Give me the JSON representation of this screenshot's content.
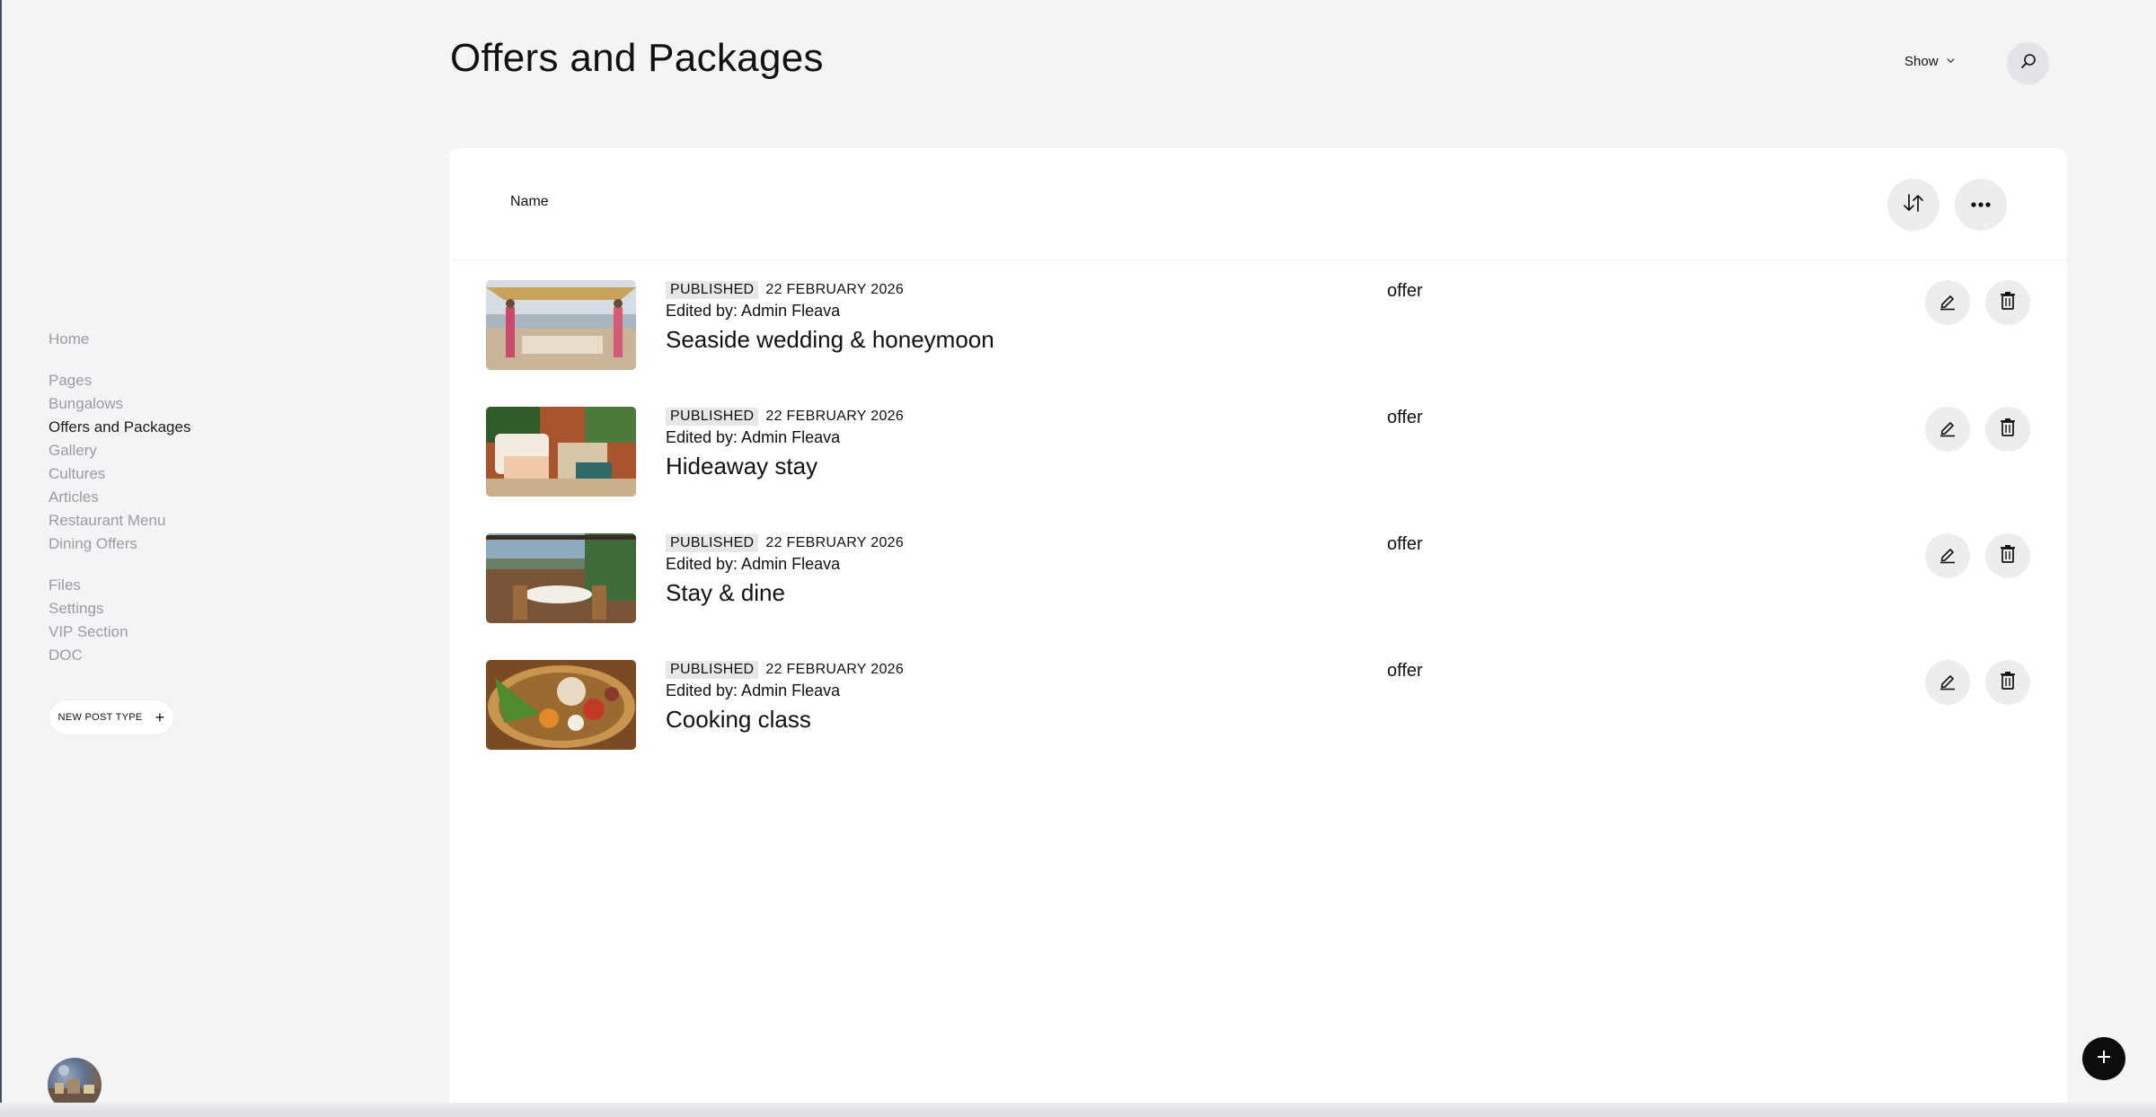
{
  "header": {
    "title": "Offers and Packages",
    "show_label": "Show"
  },
  "sidebar": {
    "groups": [
      [
        {
          "label": "Home",
          "active": false
        }
      ],
      [
        {
          "label": "Pages",
          "active": false
        },
        {
          "label": "Bungalows",
          "active": false
        },
        {
          "label": "Offers and Packages",
          "active": true
        },
        {
          "label": "Gallery",
          "active": false
        },
        {
          "label": "Cultures",
          "active": false
        },
        {
          "label": "Articles",
          "active": false
        },
        {
          "label": "Restaurant Menu",
          "active": false
        },
        {
          "label": "Dining Offers",
          "active": false
        }
      ],
      [
        {
          "label": "Files",
          "active": false
        },
        {
          "label": "Settings",
          "active": false
        },
        {
          "label": "VIP Section",
          "active": false
        },
        {
          "label": "DOC",
          "active": false
        }
      ]
    ],
    "new_post_type_label": "NEW POST TYPE"
  },
  "table": {
    "column_name": "Name",
    "rows": [
      {
        "status": "PUBLISHED",
        "date": "22 FEBRUARY 2026",
        "edited_by": "Edited by: Admin Fleava",
        "title": "Seaside wedding & honeymoon",
        "type": "offer",
        "thumbnail": "beach-wedding-image"
      },
      {
        "status": "PUBLISHED",
        "date": "22 FEBRUARY 2026",
        "edited_by": "Edited by: Admin Fleava",
        "title": "Hideaway stay",
        "type": "offer",
        "thumbnail": "bedroom-image"
      },
      {
        "status": "PUBLISHED",
        "date": "22 FEBRUARY 2026",
        "edited_by": "Edited by: Admin Fleava",
        "title": "Stay & dine",
        "type": "offer",
        "thumbnail": "restaurant-terrace-image"
      },
      {
        "status": "PUBLISHED",
        "date": "22 FEBRUARY 2026",
        "edited_by": "Edited by: Admin Fleava",
        "title": "Cooking class",
        "type": "offer",
        "thumbnail": "spices-basket-image"
      }
    ]
  },
  "icons": {
    "search": "search-icon",
    "sort": "sort-icon",
    "more": "more-icon",
    "edit": "pencil-icon",
    "delete": "trash-icon",
    "add": "plus-icon",
    "chevron": "chevron-down-icon"
  },
  "colors": {
    "background": "#f3f4f6",
    "panel": "#ffffff",
    "button": "#ededf0",
    "active_text": "#1b1b1b",
    "muted_text": "#9a9ca1",
    "fab": "#0d0d0d"
  }
}
